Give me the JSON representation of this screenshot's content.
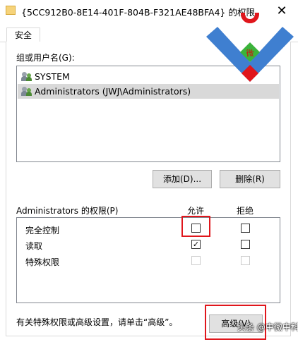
{
  "window": {
    "title": "{5CC912B0-8E14-401F-804B-F321AE48BFA4} 的权限",
    "close_glyph": "✕"
  },
  "tabs": [
    {
      "label": "安全"
    }
  ],
  "users_section": {
    "label": "组或用户名(G):",
    "items": [
      {
        "name": "SYSTEM",
        "selected": false
      },
      {
        "name": "Administrators (JWJ\\Administrators)",
        "selected": true
      }
    ],
    "add_button": "添加(D)...",
    "remove_button": "删除(R)"
  },
  "permissions": {
    "title": "Administrators 的权限(P)",
    "allow_header": "允许",
    "deny_header": "拒绝",
    "rows": [
      {
        "label": "完全控制",
        "allow": false,
        "deny": false,
        "enabled": true
      },
      {
        "label": "读取",
        "allow": true,
        "deny": false,
        "enabled": true
      },
      {
        "label": "特殊权限",
        "allow": false,
        "deny": false,
        "enabled": false
      }
    ]
  },
  "footer": {
    "hint": "有关特殊权限或高级设置，请单击“高级”。",
    "advanced_button": "高级(V)"
  },
  "watermark": {
    "badge_char": "微",
    "text": "头条 @中微中科技"
  },
  "colors": {
    "highlight_red": "#e0161c",
    "watermark_blue": "#3f7fd0",
    "watermark_green": "#3bb33b"
  }
}
